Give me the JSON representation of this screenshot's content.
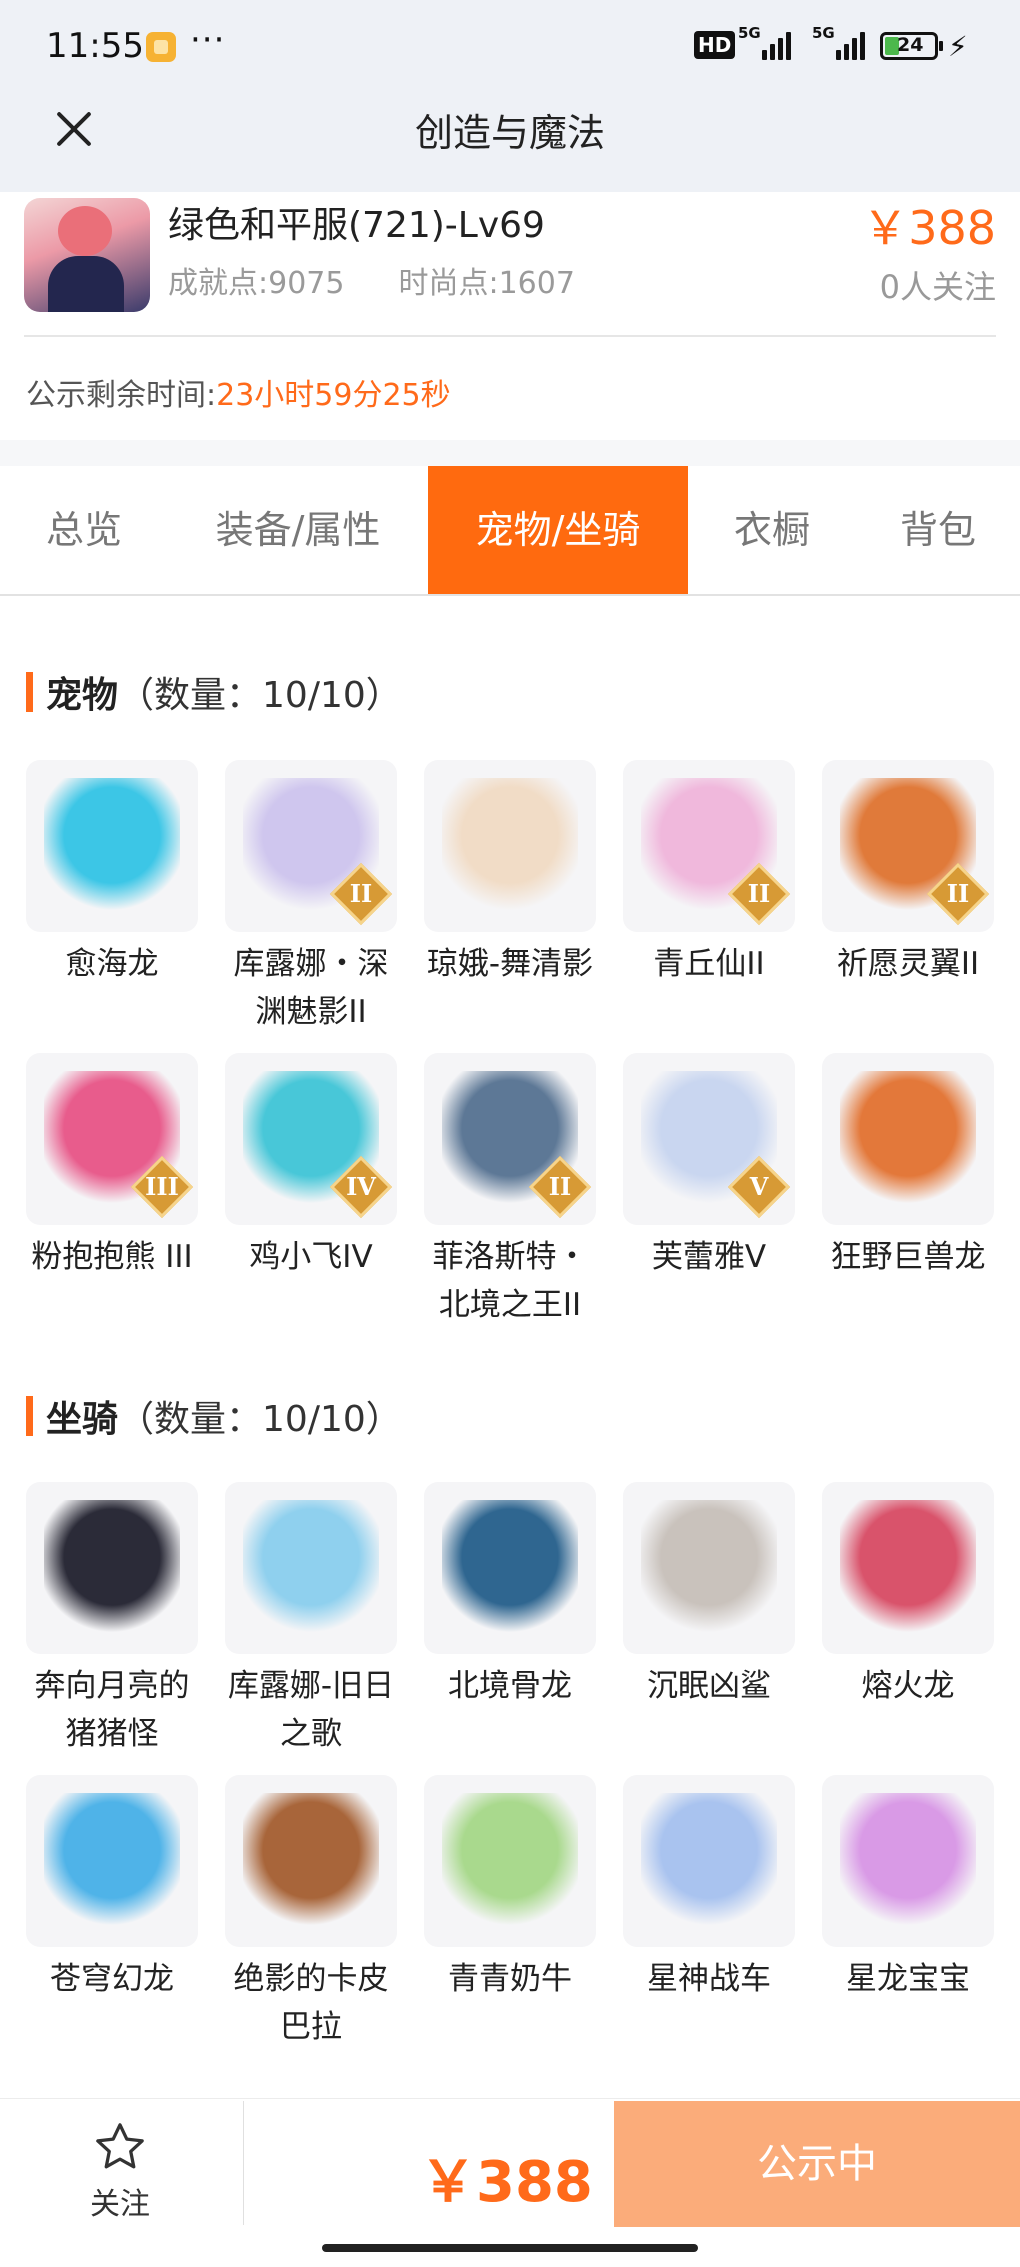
{
  "status_bar": {
    "time": "11:55",
    "dots": "···",
    "hd": "HD",
    "net1": "5G",
    "net2": "5G",
    "battery": "24",
    "bolt": "⚡"
  },
  "header": {
    "title": "创造与魔法"
  },
  "role": {
    "name": "绿色和平服(721)-Lv69",
    "achievement": "成就点:9075",
    "fashion": "时尚点:1607",
    "price": "￥388",
    "followers": "0人关注",
    "timer_label": "公示剩余时间:",
    "timer_value": "23小时59分25秒"
  },
  "tabs": [
    {
      "label": "总览",
      "active": false
    },
    {
      "label": "装备/属性",
      "active": false
    },
    {
      "label": "宠物/坐骑",
      "active": true
    },
    {
      "label": "衣橱",
      "active": false
    },
    {
      "label": "背包",
      "active": false
    }
  ],
  "pets": {
    "title": "宠物",
    "count": "（数量：10/10）",
    "items": [
      {
        "label": "愈海龙",
        "badge": "",
        "art": "cyan-dragon-icon",
        "color": "#3cc6e6"
      },
      {
        "label": "库露娜・深渊魅影II",
        "badge": "II",
        "art": "white-haired-girl-icon",
        "color": "#cfc6ee"
      },
      {
        "label": "琼娥-舞清影",
        "badge": "",
        "art": "dancer-girl-icon",
        "color": "#f1dcc6"
      },
      {
        "label": "青丘仙II",
        "badge": "II",
        "art": "fox-fairy-icon",
        "color": "#f0b8dc"
      },
      {
        "label": "祈愿灵翼II",
        "badge": "II",
        "art": "griffin-icon",
        "color": "#e07a3a"
      },
      {
        "label": "粉抱抱熊 III",
        "badge": "III",
        "art": "pink-bear-icon",
        "color": "#e85c8c"
      },
      {
        "label": "鸡小飞IV",
        "badge": "IV",
        "art": "blue-chick-icon",
        "color": "#48c7d8"
      },
      {
        "label": "菲洛斯特・北境之王II",
        "badge": "II",
        "art": "ice-king-icon",
        "color": "#5d7896"
      },
      {
        "label": "芙蕾雅V",
        "badge": "V",
        "art": "valkyrie-icon",
        "color": "#c9d6f0"
      },
      {
        "label": "狂野巨兽龙",
        "badge": "",
        "art": "beast-dragon-icon",
        "color": "#e3783a"
      }
    ]
  },
  "mounts": {
    "title": "坐骑",
    "count": "（数量：10/10）",
    "items": [
      {
        "label": "奔向月亮的猪猪怪",
        "badge": "",
        "art": "pig-monster-icon",
        "color": "#2b2b38"
      },
      {
        "label": "库露娜-旧日之歌",
        "badge": "",
        "art": "cloud-girl-icon",
        "color": "#8fd0ee"
      },
      {
        "label": "北境骨龙",
        "badge": "",
        "art": "bone-dragon-icon",
        "color": "#2f6690"
      },
      {
        "label": "沉眠凶鲨",
        "badge": "",
        "art": "shark-icon",
        "color": "#c9c2bc"
      },
      {
        "label": "熔火龙",
        "badge": "",
        "art": "lava-dragon-icon",
        "color": "#d9536b"
      },
      {
        "label": "苍穹幻龙",
        "badge": "",
        "art": "sky-dragon-icon",
        "color": "#4fb3e8"
      },
      {
        "label": "绝影的卡皮巴拉",
        "badge": "",
        "art": "capybara-icon",
        "color": "#a8653a"
      },
      {
        "label": "青青奶牛",
        "badge": "",
        "art": "green-cow-icon",
        "color": "#a9d98d"
      },
      {
        "label": "星神战车",
        "badge": "",
        "art": "star-horse-icon",
        "color": "#a9c3ef"
      },
      {
        "label": "星龙宝宝",
        "badge": "",
        "art": "star-dragon-baby-icon",
        "color": "#d99ae6"
      }
    ]
  },
  "bottom": {
    "follow_label": "关注",
    "price": "￥388",
    "status_button": "公示中"
  },
  "colors": {
    "accent": "#ff6a1a",
    "tab_active": "#ff6a0f",
    "status_button": "#fbac7a"
  }
}
